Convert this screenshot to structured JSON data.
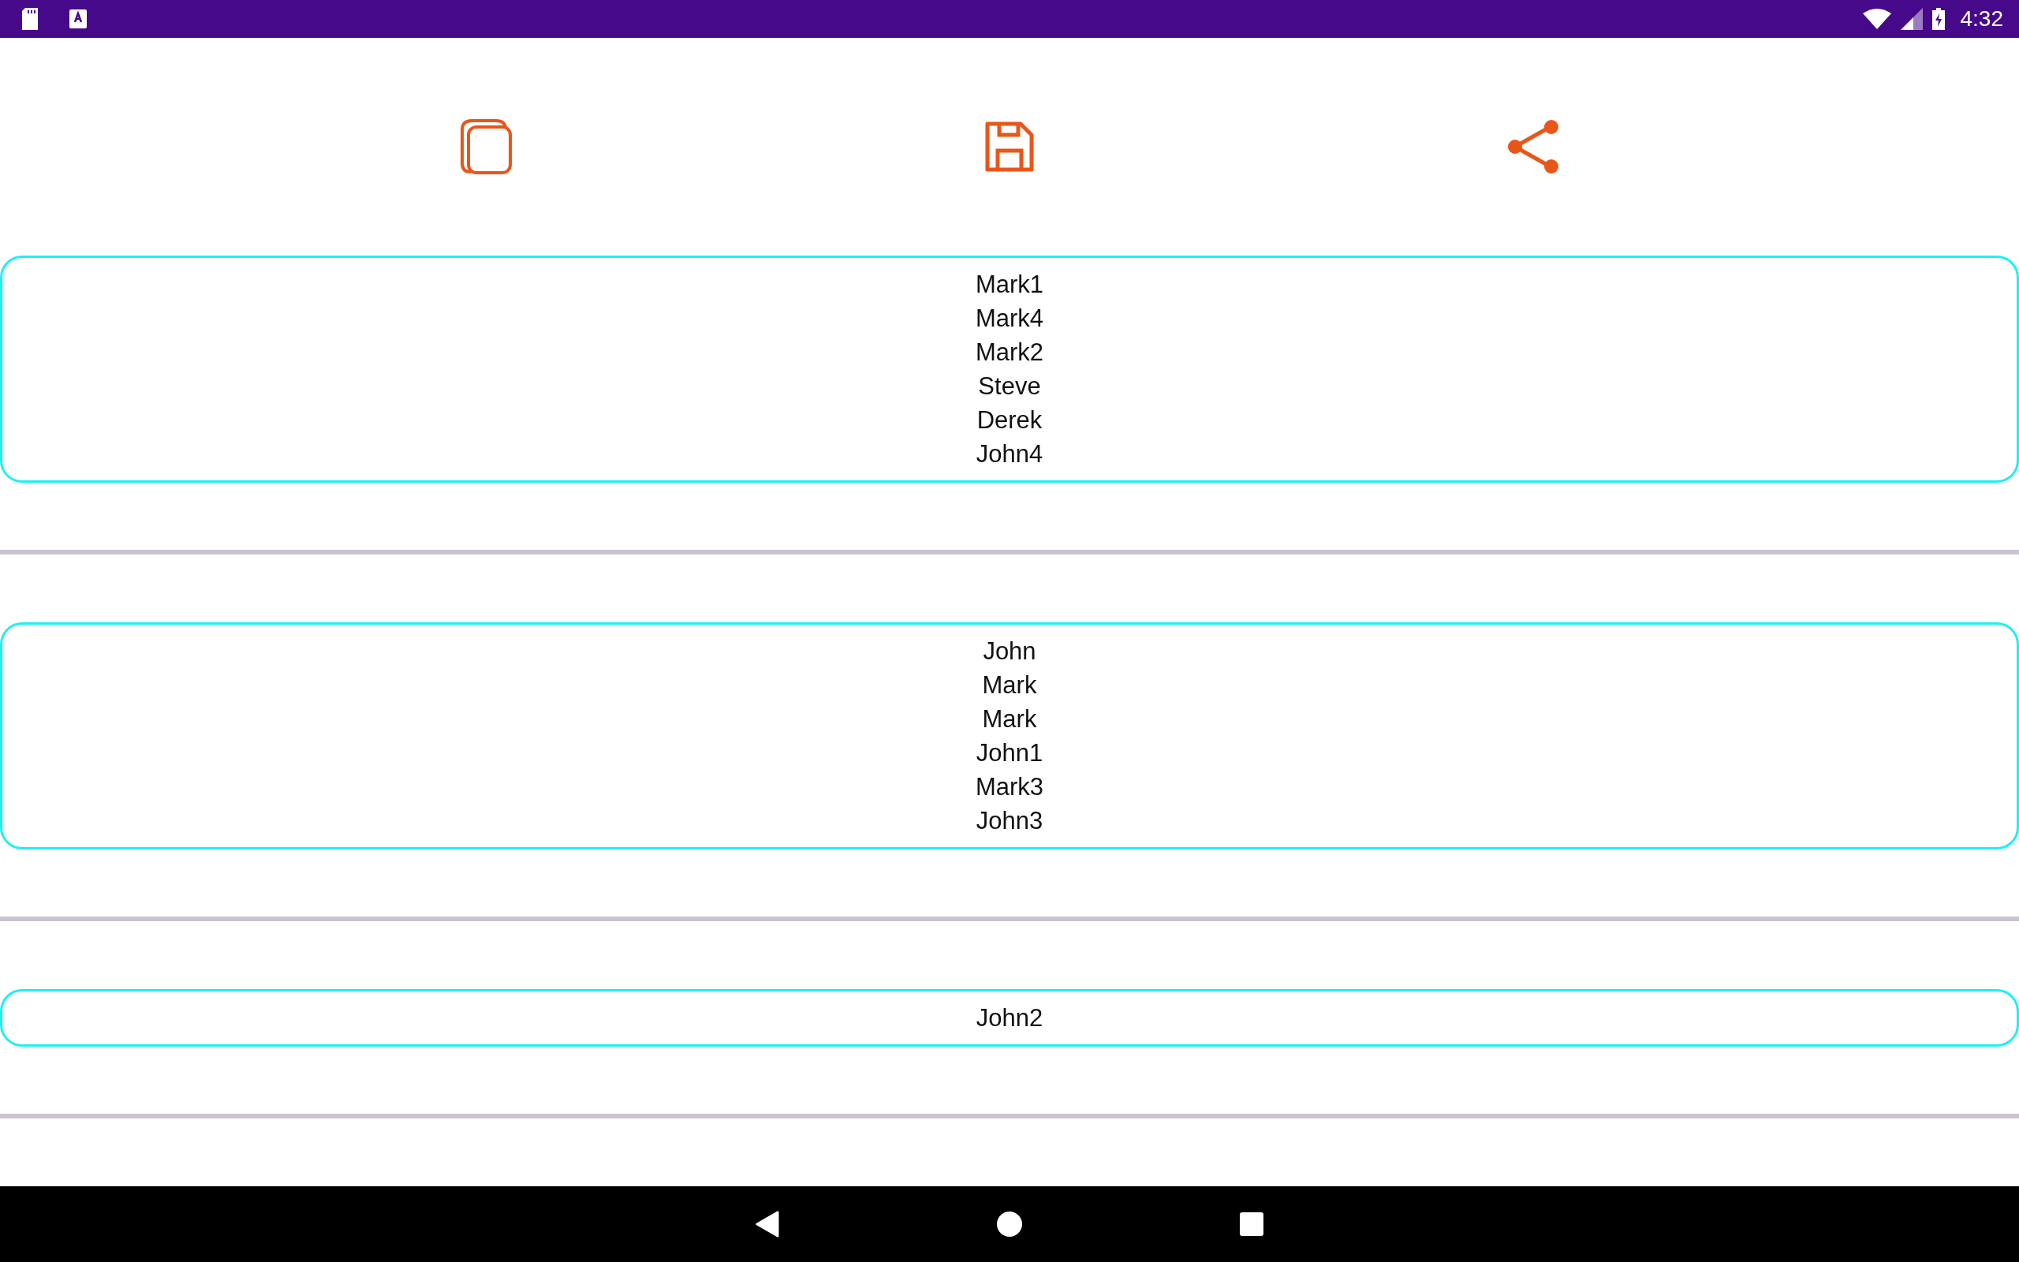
{
  "status_bar": {
    "time": "4:32"
  },
  "groups": [
    {
      "names": [
        "Mark1",
        "Mark4",
        "Mark2",
        "Steve",
        "Derek",
        "John4"
      ]
    },
    {
      "names": [
        "John",
        "Mark",
        "Mark",
        "John1",
        "Mark3",
        "John3"
      ]
    },
    {
      "names": [
        "John2"
      ]
    }
  ]
}
